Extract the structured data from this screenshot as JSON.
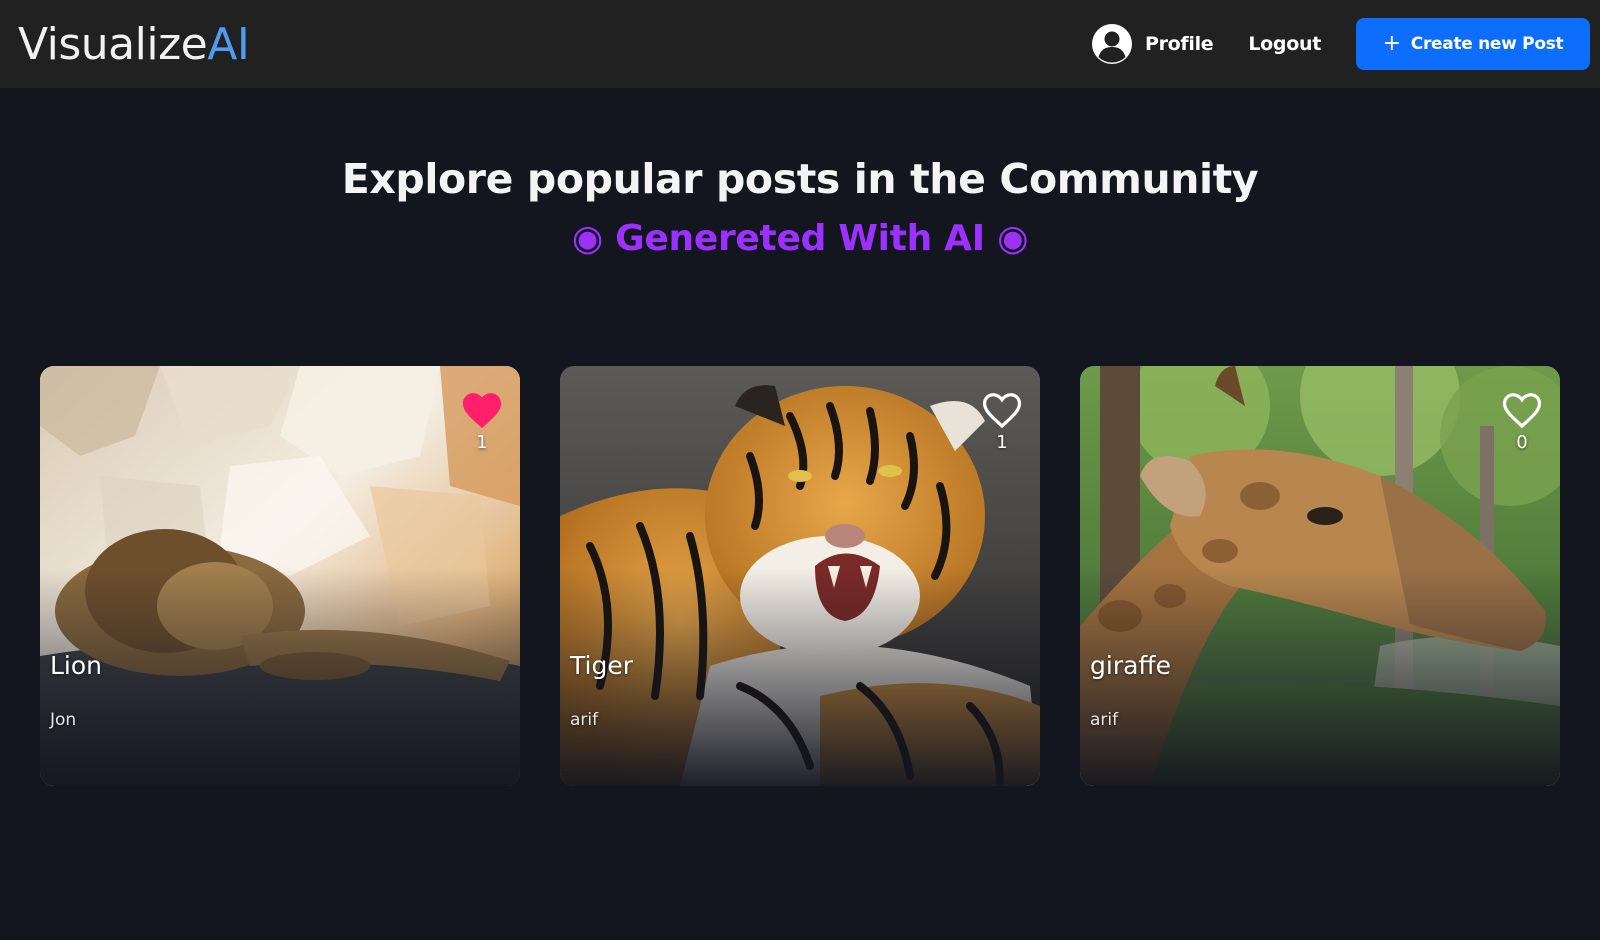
{
  "header": {
    "logo_main": "Visualize",
    "logo_accent": "AI",
    "profile_label": "Profile",
    "logout_label": "Logout",
    "create_plus": "+",
    "create_label": "Create new Post"
  },
  "hero": {
    "title": "Explore popular posts in the Community",
    "subtitle": "◉ Genereted With AI ◉"
  },
  "posts": [
    {
      "title": "Lion",
      "author": "Jon",
      "likes": "1",
      "liked": true,
      "subject": "lion-image"
    },
    {
      "title": "Tiger",
      "author": "arif",
      "likes": "1",
      "liked": false,
      "subject": "tiger-image"
    },
    {
      "title": "giraffe",
      "author": "arif",
      "likes": "0",
      "liked": false,
      "subject": "giraffe-image"
    }
  ],
  "colors": {
    "navbar_bg": "#212121",
    "page_bg": "#13151f",
    "logo_accent": "#4f9cf0",
    "button_blue": "#0d6efd",
    "subtitle_purple": "#9b30ff",
    "like_active": "#ff1f6b"
  }
}
